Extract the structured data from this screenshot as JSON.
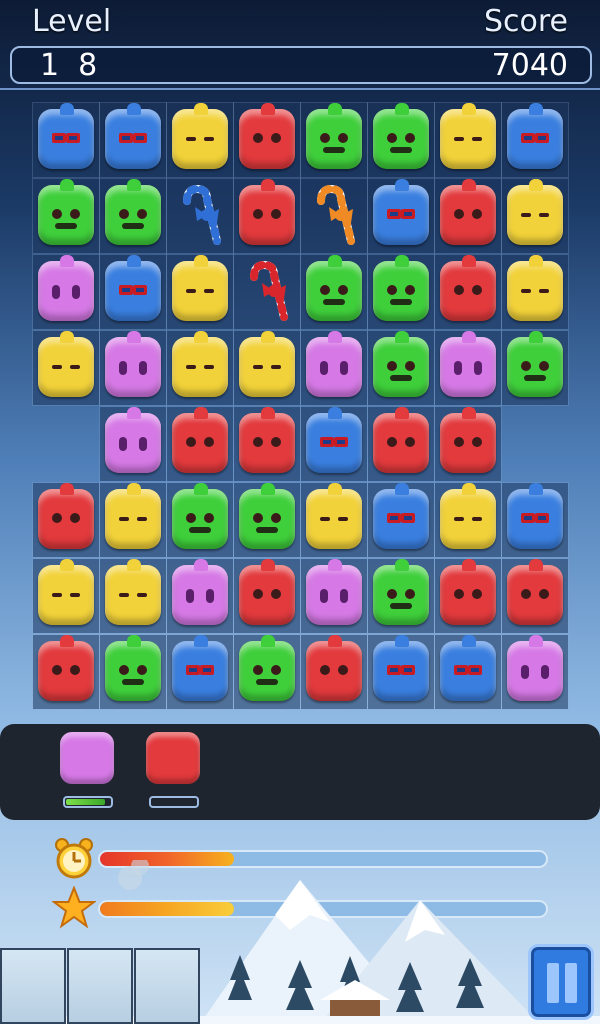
{
  "header": {
    "level_label": "Level",
    "score_label": "Score",
    "level_value": "1  8",
    "score_value": "7040"
  },
  "board": {
    "rows": [
      [
        "blue",
        "blue",
        "yellow",
        "red",
        "green",
        "green",
        "yellow",
        "blue"
      ],
      [
        "green",
        "green",
        "cane-blue",
        "red",
        "cane-orange",
        "blue",
        "red",
        "yellow"
      ],
      [
        "pink",
        "blue",
        "yellow",
        "cane-red",
        "green",
        "green",
        "red",
        "yellow"
      ],
      [
        "yellow",
        "pink",
        "yellow",
        "yellow",
        "pink",
        "green",
        "pink",
        "green"
      ],
      [
        "empty",
        "pink",
        "red",
        "red",
        "blue",
        "red",
        "red",
        "empty"
      ],
      [
        "red",
        "yellow",
        "green",
        "green",
        "yellow",
        "blue",
        "yellow",
        "blue"
      ],
      [
        "yellow",
        "yellow",
        "pink",
        "red",
        "pink",
        "green",
        "red",
        "red"
      ],
      [
        "red",
        "green",
        "blue",
        "green",
        "red",
        "blue",
        "blue",
        "pink"
      ]
    ]
  },
  "inventory": {
    "items": [
      {
        "color": "pink",
        "charge": 0.85
      },
      {
        "color": "red",
        "charge": 0.0
      }
    ]
  },
  "meters": {
    "time_progress": 0.3,
    "star_progress": 0.3
  },
  "colors": {
    "red": "#e23a3d",
    "blue": "#3a7fe0",
    "yellow": "#f2d23a",
    "green": "#3fcf3b",
    "pink": "#d679e6",
    "time_fill": "#f0642a",
    "star_fill": "#f6a623"
  },
  "icons": {
    "timer": "alarm-clock-icon",
    "star": "star-icon",
    "pause": "pause-icon"
  }
}
